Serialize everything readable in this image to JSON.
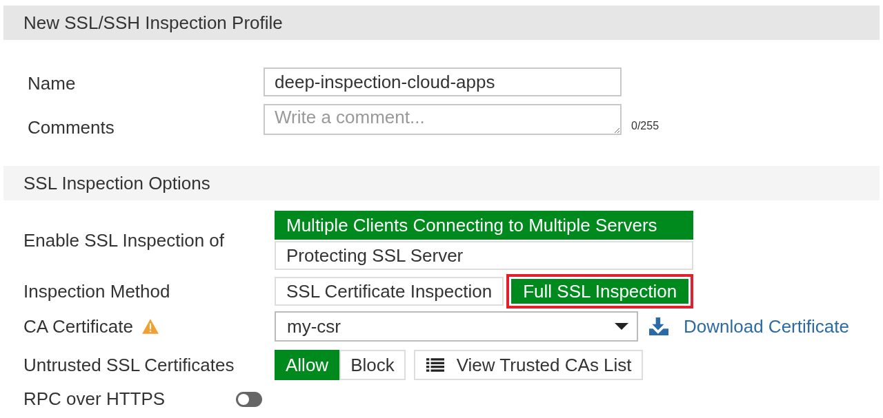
{
  "header": {
    "title": "New SSL/SSH Inspection Profile"
  },
  "name_field": {
    "label": "Name",
    "value": "deep-inspection-cloud-apps"
  },
  "comments_field": {
    "label": "Comments",
    "placeholder": "Write a comment...",
    "counter": "0/255"
  },
  "section": {
    "title": "SSL Inspection Options"
  },
  "enable_ssl": {
    "label": "Enable SSL Inspection of",
    "options": [
      {
        "label": "Multiple Clients Connecting to Multiple Servers",
        "selected": true
      },
      {
        "label": "Protecting SSL Server",
        "selected": false
      }
    ]
  },
  "inspection_method": {
    "label": "Inspection Method",
    "options": [
      {
        "label": "SSL Certificate Inspection",
        "selected": false,
        "highlighted": false
      },
      {
        "label": "Full SSL Inspection",
        "selected": true,
        "highlighted": true
      }
    ]
  },
  "ca_certificate": {
    "label": "CA Certificate",
    "warning": true,
    "value": "my-csr",
    "link": "Download Certificate"
  },
  "untrusted": {
    "label": "Untrusted SSL Certificates",
    "options": [
      {
        "label": "Allow",
        "selected": true
      },
      {
        "label": "Block",
        "selected": false
      }
    ],
    "button": "View Trusted CAs List"
  },
  "rpc": {
    "label": "RPC over HTTPS",
    "on": false
  }
}
